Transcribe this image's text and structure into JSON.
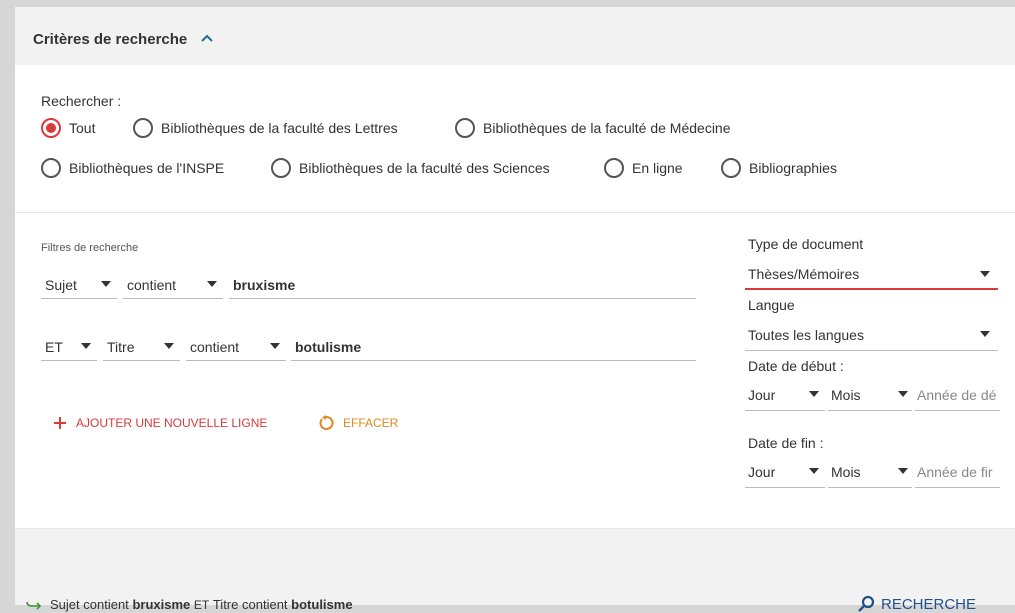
{
  "header": {
    "title": "Critères de recherche"
  },
  "scope": {
    "label": "Rechercher :",
    "options": [
      {
        "label": "Tout",
        "selected": true
      },
      {
        "label": "Bibliothèques de la faculté des Lettres",
        "selected": false
      },
      {
        "label": "Bibliothèques de la faculté de Médecine",
        "selected": false
      },
      {
        "label": "Bibliothèques de l'INSPE",
        "selected": false
      },
      {
        "label": "Bibliothèques de la faculté des Sciences",
        "selected": false
      },
      {
        "label": "En ligne",
        "selected": false
      },
      {
        "label": "Bibliographies",
        "selected": false
      }
    ]
  },
  "filters": {
    "label": "Filtres de recherche",
    "row1": {
      "field": "Sujet",
      "operator": "contient",
      "value": "bruxisme"
    },
    "row2": {
      "bool": "ET",
      "field": "Titre",
      "operator": "contient",
      "value": "botulisme"
    },
    "add_line": "AJOUTER UNE NOUVELLE LIGNE",
    "clear": "EFFACER"
  },
  "sidebar": {
    "doc_type_label": "Type de document",
    "doc_type_value": "Thèses/Mémoires",
    "lang_label": "Langue",
    "lang_value": "Toutes les langues",
    "start_label": "Date de début :",
    "end_label": "Date de fin :",
    "day": "Jour",
    "month": "Mois",
    "year_start_placeholder": "Année de dé",
    "year_end_placeholder": "Année de fir"
  },
  "footer": {
    "s1": "Sujet",
    "s2": "contient",
    "s3": "bruxisme",
    "s4": "ET",
    "s5": "Titre",
    "s6": "contient",
    "s7": "botulisme",
    "search": "RECHERCHE"
  },
  "colors": {
    "accent_red": "#d93a3a",
    "link_blue": "#1f4f8b",
    "clear_orange": "#e08a1e",
    "arrow_green": "#3a9a3a"
  }
}
